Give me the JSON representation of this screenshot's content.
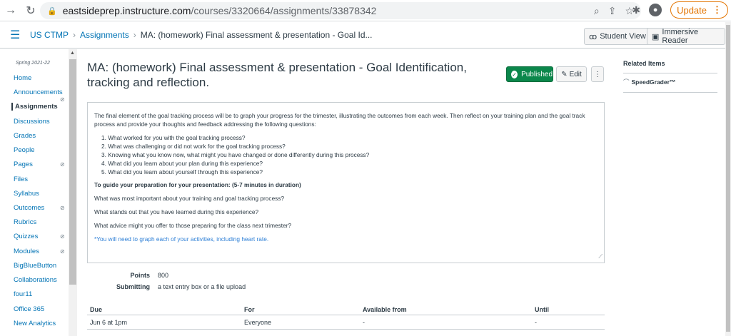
{
  "browser": {
    "url_host": "eastsideprep.instructure.com",
    "url_path": "/courses/3320664/assignments/33878342",
    "update_label": "Update"
  },
  "header": {
    "course": "US CTMP",
    "crumb_assignments": "Assignments",
    "crumb_current": "MA: (homework) Final assessment & presentation - Goal Id...",
    "student_view": "Student View",
    "immersive_reader": "Immersive Reader"
  },
  "sidebar": {
    "term": "Spring 2021-22",
    "items": [
      {
        "label": "Home"
      },
      {
        "label": "Announcements"
      },
      {
        "label": "Assignments"
      },
      {
        "label": "Discussions"
      },
      {
        "label": "Grades"
      },
      {
        "label": "People"
      },
      {
        "label": "Pages"
      },
      {
        "label": "Files"
      },
      {
        "label": "Syllabus"
      },
      {
        "label": "Outcomes"
      },
      {
        "label": "Rubrics"
      },
      {
        "label": "Quizzes"
      },
      {
        "label": "Modules"
      },
      {
        "label": "BigBlueButton"
      },
      {
        "label": "Collaborations"
      },
      {
        "label": "four11"
      },
      {
        "label": "Office 365"
      },
      {
        "label": "New Analytics"
      }
    ]
  },
  "assignment": {
    "title": "MA: (homework) Final assessment & presentation - Goal Identification, tracking and reflection.",
    "published_label": "Published",
    "edit_label": "Edit",
    "intro": "The final element of the goal tracking process will be to graph your progress for the trimester, illustrating the outcomes from each week. Then reflect on your training plan and the goal track process and provide your thoughts and feedback addressing the following questions:",
    "questions": [
      "1. What worked for you with the goal tracking process?",
      "2. What was challenging or did not work for the goal tracking process?",
      "3. Knowing what you know now, what might you have changed or done differently during this process?",
      "4. What did you learn about your plan during this experience?",
      "5. What did you learn about yourself through this experience?"
    ],
    "guide_heading": "To guide your preparation for your presentation: (5-7 minutes in duration)",
    "guide_q1": "What was most important about your training and goal tracking process?",
    "guide_q2": "What stands out that you have learned during this experience?",
    "guide_q3": "What advice might you offer to those preparing for the class next trimester?",
    "note": "*You will need to graph each of your activities, including heart rate.",
    "points_label": "Points",
    "points_value": "800",
    "submitting_label": "Submitting",
    "submitting_value": "a text entry box or a file upload"
  },
  "dates_table": {
    "headers": [
      "Due",
      "For",
      "Available from",
      "Until"
    ],
    "rows": [
      [
        "Jun 6 at 1pm",
        "Everyone",
        "-",
        "-"
      ]
    ]
  },
  "related": {
    "heading": "Related Items",
    "speedgrader": "SpeedGrader™"
  },
  "colors": {
    "link": "#0374b5",
    "published": "#0b874b",
    "text": "#2d3b45"
  }
}
